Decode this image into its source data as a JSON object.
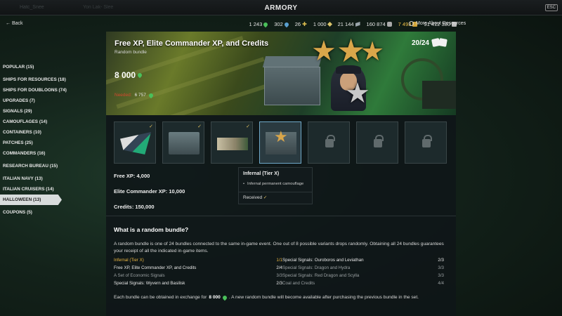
{
  "window": {
    "title": "ARMORY",
    "esc": "ESC",
    "ghost_left": "Hatc_Snee",
    "ghost_mid": "Yon Lak- Slee"
  },
  "nav": {
    "back": "Back"
  },
  "resources": [
    {
      "value": "1 243",
      "icon": "elite-xp-icon",
      "gold": false
    },
    {
      "value": "302",
      "icon": "commander-xp-icon",
      "gold": false
    },
    {
      "value": "26",
      "icon": "signals-icon",
      "gold": false
    },
    {
      "value": "1 000",
      "icon": "coal-icon",
      "gold": false
    },
    {
      "value": "21 144",
      "icon": "steel-icon",
      "gold": false
    },
    {
      "value": "160 874",
      "icon": "research-points-icon",
      "gold": false
    },
    {
      "value": "7 493",
      "icon": "doubloons-icon",
      "gold": true
    },
    {
      "value": "91 412 380",
      "icon": "credits-icon",
      "gold": false
    }
  ],
  "more_resources": "More About Resources",
  "sidebar": {
    "items": [
      {
        "label": "POPULAR (15)",
        "active": false
      },
      {
        "label": "SHIPS FOR RESOURCES (18)",
        "active": false
      },
      {
        "label": "SHIPS FOR DOUBLOONS (74)",
        "active": false
      },
      {
        "label": "UPGRADES (7)",
        "active": false
      },
      {
        "label": "SIGNALS (29)",
        "active": false
      },
      {
        "label": "CAMOUFLAGES (14)",
        "active": false
      },
      {
        "label": "CONTAINERS (10)",
        "active": false
      },
      {
        "label": "PATCHES (25)",
        "active": false
      },
      {
        "label": "COMMANDERS (16)",
        "active": false
      },
      {
        "label": "RESEARCH BUREAU (15)",
        "active": false
      },
      {
        "label": "ITALIAN NAVY (13)",
        "active": false
      },
      {
        "label": "ITALIAN CRUISERS (14)",
        "active": false
      },
      {
        "label": "HALLOWEEN (13)",
        "active": true
      },
      {
        "label": "COUPONS (5)",
        "active": false
      }
    ]
  },
  "banner": {
    "title": "Free XP, Elite Commander XP, and Credits",
    "subtitle": "Random bundle",
    "price": "8 000",
    "needed_label": "Needed:",
    "needed_value": "6 757",
    "count": "20/24"
  },
  "thumbnails": [
    {
      "name": "thumb-signal-flag",
      "art": "flag",
      "check": true,
      "selected": false
    },
    {
      "name": "thumb-container",
      "art": "box",
      "check": true,
      "selected": false
    },
    {
      "name": "thumb-camouflage",
      "art": "camo",
      "check": true,
      "selected": false
    },
    {
      "name": "thumb-bundle",
      "art": "mix",
      "check": false,
      "selected": true
    },
    {
      "name": "thumb-locked-1",
      "art": "lock",
      "check": false,
      "selected": false
    },
    {
      "name": "thumb-locked-2",
      "art": "lock",
      "check": false,
      "selected": false
    },
    {
      "name": "thumb-locked-3",
      "art": "lock",
      "check": false,
      "selected": false
    }
  ],
  "details": {
    "free_xp": "Free XP: 4,000",
    "elite_xp": "Elite Commander XP: 10,000",
    "credits": "Credits: 150,000"
  },
  "tooltip": {
    "title": "Infernal (Tier X)",
    "item": "Infernal permanent camouflage",
    "received": "Received"
  },
  "info": {
    "heading": "What is a random bundle?",
    "text": "A random bundle is one of 24 bundles connected to the same in-game event. One out of 8 possible variants drops randomly. Obtaining all 24 bundles guarantees your receipt of all the indicated in-game items.",
    "bundles": [
      {
        "name": "Infernal (Tier X)",
        "count": "1/1",
        "style": "gold"
      },
      {
        "name": "Special Signals: Ouroboros and Leviathan",
        "count": "2/3",
        "style": "white"
      },
      {
        "name": "Free XP, Elite Commander XP, and Credits",
        "count": "2/4",
        "style": "white"
      },
      {
        "name": "Special Signals: Dragon and Hydra",
        "count": "3/3",
        "style": "dim"
      },
      {
        "name": "A Set of Economic Signals",
        "count": "3/3",
        "style": "dim"
      },
      {
        "name": "Special Signals: Red Dragon and Scylla",
        "count": "3/3",
        "style": "dim"
      },
      {
        "name": "Special Signals: Wyvern and Basilisk",
        "count": "2/3",
        "style": "white"
      },
      {
        "name": "Coal and Credits",
        "count": "4/4",
        "style": "dim"
      }
    ],
    "footer_pre": "Each bundle can be obtained in exchange for",
    "footer_price": "8 000",
    "footer_post": ". A new random bundle will become available after purchasing the previous bundle in the set."
  },
  "colors": {
    "gold": "#e8b542",
    "green": "#4ac05a",
    "needed_red": "#d2472e",
    "active_bg": "#d8dcdc"
  }
}
